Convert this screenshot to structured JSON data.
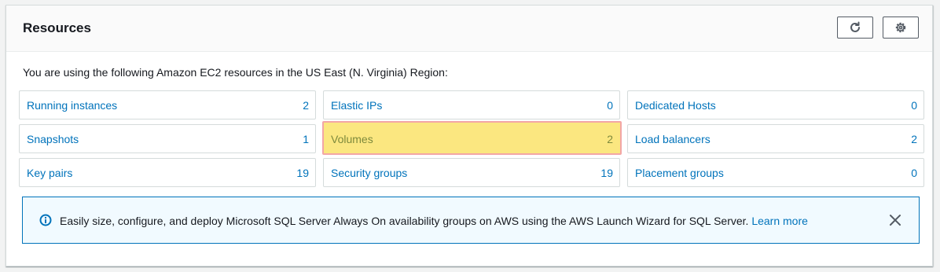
{
  "panel": {
    "title": "Resources",
    "refresh_icon": "refresh-icon",
    "settings_icon": "gear-icon"
  },
  "intro_text": "You are using the following Amazon EC2 resources in the US East (N. Virginia) Region:",
  "resources": [
    {
      "label": "Running instances",
      "count": "2"
    },
    {
      "label": "Elastic IPs",
      "count": "0"
    },
    {
      "label": "Dedicated Hosts",
      "count": "0"
    },
    {
      "label": "Snapshots",
      "count": "1"
    },
    {
      "label": "Volumes",
      "count": "2",
      "highlighted": true
    },
    {
      "label": "Load balancers",
      "count": "2"
    },
    {
      "label": "Key pairs",
      "count": "19"
    },
    {
      "label": "Security groups",
      "count": "19"
    },
    {
      "label": "Placement groups",
      "count": "0"
    }
  ],
  "alert": {
    "icon": "info-icon",
    "text": "Easily size, configure, and deploy Microsoft SQL Server Always On availability groups on AWS using the AWS Launch Wizard for SQL Server.",
    "link": "Learn more",
    "close_icon": "close-icon"
  },
  "colors": {
    "link": "#0073bb",
    "highlight_bg": "#fbe780",
    "highlight_border": "#f3a6a6",
    "alert_bg": "#f1faff",
    "alert_border": "#0073bb"
  }
}
